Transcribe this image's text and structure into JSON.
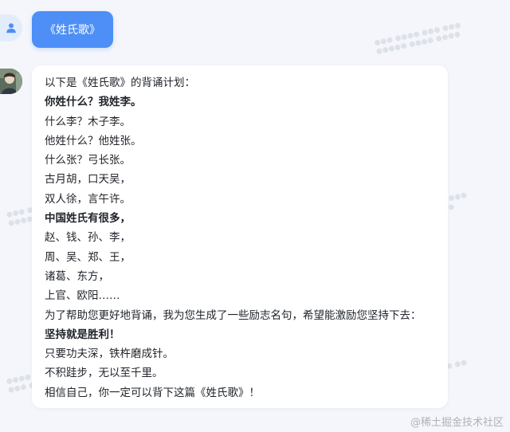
{
  "user_message": {
    "text": "《姓氏歌》"
  },
  "bot_message": {
    "lines": [
      {
        "text": "以下是《姓氏歌》的背诵计划：",
        "bold": false
      },
      {
        "text": "你姓什么？我姓李。",
        "bold": true
      },
      {
        "text": "什么李？木子李。",
        "bold": false
      },
      {
        "text": "他姓什么？他姓张。",
        "bold": false
      },
      {
        "text": "什么张？弓长张。",
        "bold": false
      },
      {
        "text": "古月胡，口天吴，",
        "bold": false
      },
      {
        "text": "双人徐，言午许。",
        "bold": false
      },
      {
        "text": "中国姓氏有很多，",
        "bold": true
      },
      {
        "text": "赵、钱、孙、李，",
        "bold": false
      },
      {
        "text": "周、吴、郑、王，",
        "bold": false
      },
      {
        "text": "诸葛、东方，",
        "bold": false
      },
      {
        "text": "上官、欧阳……",
        "bold": false
      },
      {
        "text": "为了帮助您更好地背诵，我为您生成了一些励志名句，希望能激励您坚持下去：",
        "bold": false
      },
      {
        "text": "坚持就是胜利！",
        "bold": true
      },
      {
        "text": "只要功夫深，铁杵磨成针。",
        "bold": false
      },
      {
        "text": "不积跬步，无以至千里。",
        "bold": false
      },
      {
        "text": "相信自己，你一定可以背下这篇《姓氏歌》！",
        "bold": false
      }
    ]
  },
  "footer": {
    "watermark": "@稀土掘金技术社区"
  },
  "icons": {
    "user_avatar": "person-icon",
    "bot_avatar": "bot-avatar-image"
  },
  "colors": {
    "background": "#f4f6fb",
    "user_bubble": "#4d8ff6",
    "user_avatar_bg": "#e3ecfb",
    "text": "#1f2329"
  }
}
